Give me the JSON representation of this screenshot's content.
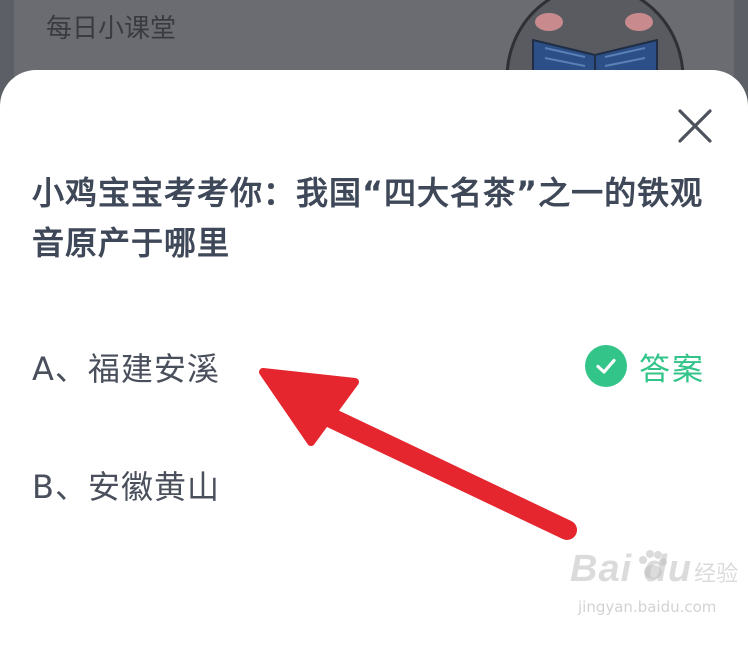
{
  "background": {
    "title": "每日小课堂"
  },
  "quiz": {
    "question": "小鸡宝宝考考你：我国“四大名茶”之一的铁观音原产于哪里",
    "options": [
      {
        "label": "A、福建安溪",
        "is_answer": true
      },
      {
        "label": "B、安徽黄山",
        "is_answer": false
      }
    ],
    "answer_label": "答案"
  },
  "watermark": {
    "logo": "Bai du",
    "brand": "经验",
    "url": "jingyan.baidu.com"
  },
  "colors": {
    "accent_green": "#33c48a",
    "arrow_red": "#e5262e",
    "question_text": "#3f4858"
  },
  "icons": [
    "close-icon",
    "check-circle-icon",
    "arrow-annotation-icon",
    "paw-icon"
  ]
}
